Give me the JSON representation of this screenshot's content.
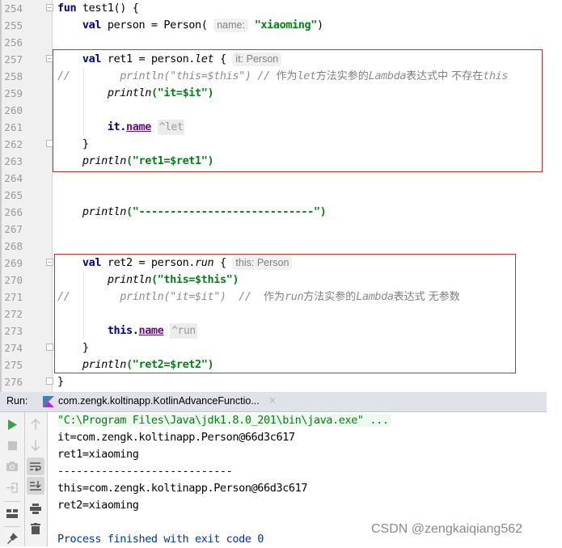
{
  "editor": {
    "lines": [
      {
        "num": "254"
      },
      {
        "num": "255"
      },
      {
        "num": "256"
      },
      {
        "num": "257"
      },
      {
        "num": "258"
      },
      {
        "num": "259"
      },
      {
        "num": "260"
      },
      {
        "num": "261"
      },
      {
        "num": "262"
      },
      {
        "num": "263"
      },
      {
        "num": "264"
      },
      {
        "num": "265"
      },
      {
        "num": "266"
      },
      {
        "num": "267"
      },
      {
        "num": "268"
      },
      {
        "num": "269"
      },
      {
        "num": "270"
      },
      {
        "num": "271"
      },
      {
        "num": "272"
      },
      {
        "num": "273"
      },
      {
        "num": "274"
      },
      {
        "num": "275"
      },
      {
        "num": "276"
      }
    ],
    "tokens": {
      "fun_kw": "fun",
      "fun_sig": " test1() {",
      "val_kw": "val",
      "person_decl": " person = Person(",
      "hint_name": "name:",
      "xiaoming_str": "\"xiaoming\"",
      "close_paren": ")",
      "ret1_decl": " ret1 = person.",
      "let_fn": "let",
      "open_brace": " {",
      "hint_it_person": "it: Person",
      "comment_258_prefix": "//        println(\"this=$this\") // ",
      "comment_258_cjk1": "作为",
      "comment_258_let": "let",
      "comment_258_cjk2": "方法实参的",
      "comment_258_lambda": "Lambda",
      "comment_258_cjk3": "表达式中 不存在",
      "comment_258_this": "this",
      "println": "println",
      "it_str": "(\"it=$it\")",
      "it_prefix": "it.",
      "name_prop": "name",
      "hint_let": "^let",
      "close_brace": "}",
      "ret1_str": "(\"ret1=$ret1\")",
      "dash_str": "(\"----------------------------\")",
      "ret2_decl": " ret2 = person.",
      "run_fn": "run",
      "hint_this_person": "this: Person",
      "this_str": "(\"this=$this\")",
      "comment_271_prefix": "//        println(\"it=$it\")  //  ",
      "comment_271_cjk1": "作为",
      "comment_271_run": "run",
      "comment_271_cjk2": "方法实参的",
      "comment_271_lambda": "Lambda",
      "comment_271_cjk3": "表达式 无参数",
      "this_prefix": "this.",
      "hint_run": "^run",
      "ret2_str": "(\"ret2=$ret2\")"
    }
  },
  "run_panel": {
    "label": "Run:",
    "tab_title": "com.zengk.koltinapp.KotlinAdvanceFunctio...",
    "tab_close": "×",
    "console": [
      "\"C:\\Program Files\\Java\\jdk1.8.0_201\\bin\\java.exe\" ...",
      "it=com.zengk.koltinapp.Person@66d3c617",
      "ret1=xiaoming",
      "----------------------------",
      "this=com.zengk.koltinapp.Person@66d3c617",
      "ret2=xiaoming",
      "",
      "Process finished with exit code 0"
    ],
    "toolbar_left": [
      "run-icon",
      "stop-icon",
      "camera-icon",
      "login-icon",
      "layout-icon",
      "pin-icon"
    ],
    "toolbar_right": [
      "arrow-up-icon",
      "arrow-down-icon",
      "soft-wrap-icon",
      "scroll-to-end-icon",
      "print-icon",
      "trash-icon"
    ]
  },
  "watermark": "CSDN @zengkaiqiang562",
  "colors": {
    "keyword": "#000080",
    "string": "#067d17",
    "property": "#660e7a",
    "highlight_box": "#d62a2a",
    "run_green": "#3fa04c"
  }
}
